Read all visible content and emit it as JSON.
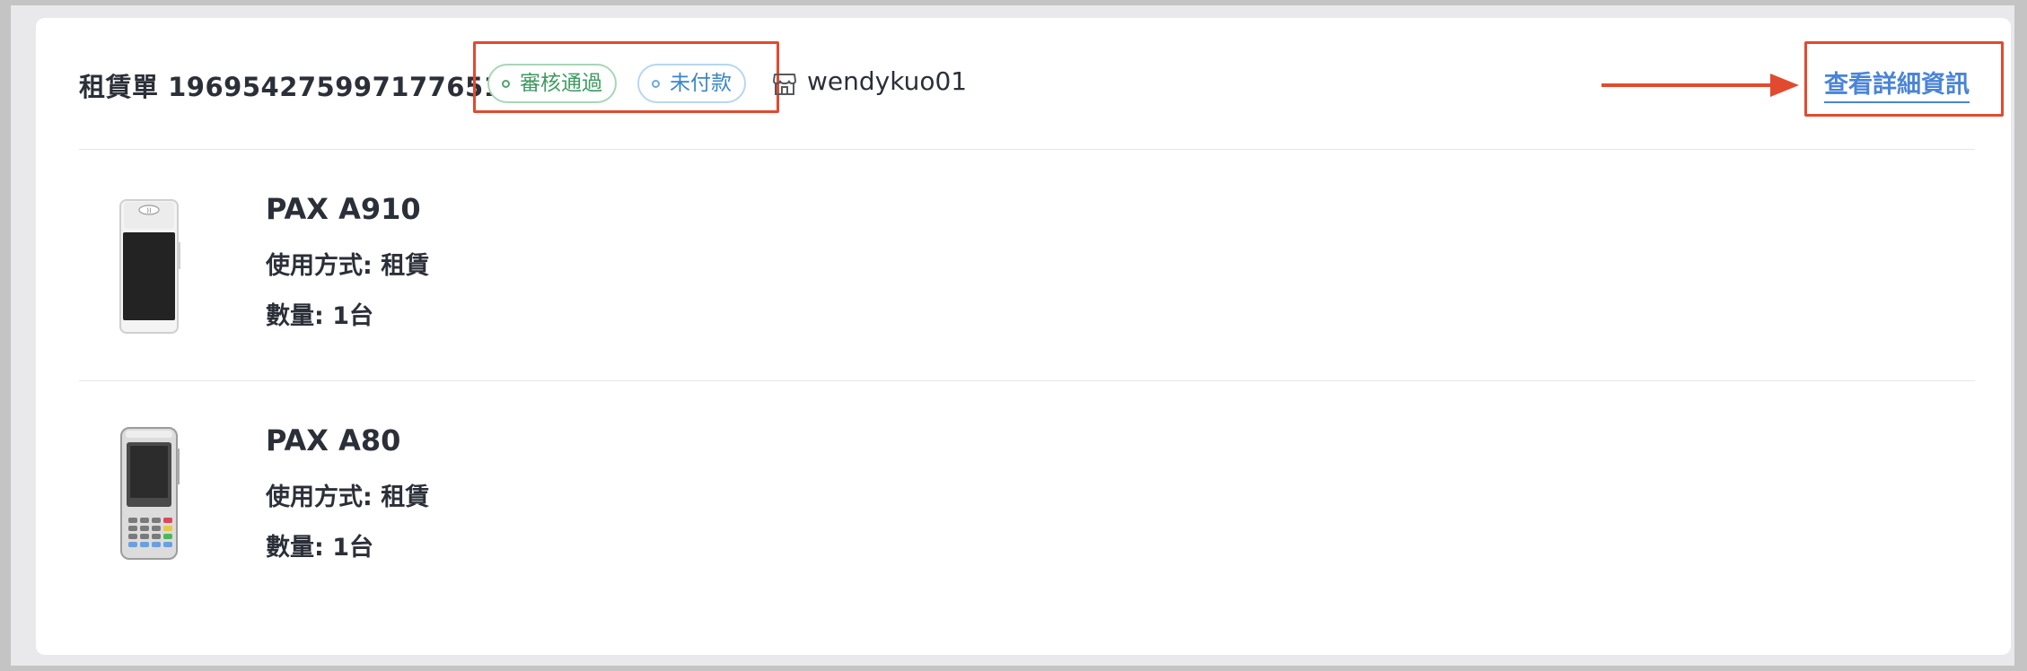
{
  "order": {
    "label": "租賃單",
    "number": "1969542759971776512",
    "tags": [
      {
        "label": "審核通過",
        "status": "approved",
        "color": "#3f9a61"
      },
      {
        "label": "未付款",
        "status": "unpaid",
        "color": "#3a86c8"
      }
    ],
    "store_icon": "store-icon",
    "username": "wendykuo01",
    "detail_link": "查看詳細資訊"
  },
  "items": [
    {
      "name": "PAX A910",
      "usage": "使用方式: 租賃",
      "quantity": "數量: 1台",
      "image": "pax-a910-terminal"
    },
    {
      "name": "PAX A80",
      "usage": "使用方式: 租賃",
      "quantity": "數量: 1台",
      "image": "pax-a80-terminal"
    }
  ],
  "colors": {
    "annotation_red": "#e24a2f",
    "link_blue": "#4a84d8",
    "text_dark": "#2b2f38"
  }
}
